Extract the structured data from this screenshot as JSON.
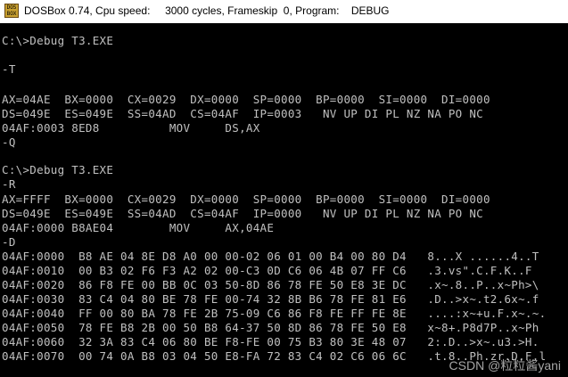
{
  "window": {
    "title": "DOSBox 0.74, Cpu speed:     3000 cycles, Frameskip  0, Program:    DEBUG",
    "icon": "dosbox-app-icon",
    "icon_text": "DOS BOX"
  },
  "console": {
    "lines": [
      "C:\\>Debug T3.EXE",
      "",
      "-T",
      "",
      "AX=04AE  BX=0000  CX=0029  DX=0000  SP=0000  BP=0000  SI=0000  DI=0000",
      "DS=049E  ES=049E  SS=04AD  CS=04AF  IP=0003   NV UP DI PL NZ NA PO NC",
      "04AF:0003 8ED8          MOV     DS,AX",
      "-Q",
      "",
      "C:\\>Debug T3.EXE",
      "-R",
      "AX=FFFF  BX=0000  CX=0029  DX=0000  SP=0000  BP=0000  SI=0000  DI=0000",
      "DS=049E  ES=049E  SS=04AD  CS=04AF  IP=0000   NV UP DI PL NZ NA PO NC",
      "04AF:0000 B8AE04        MOV     AX,04AE",
      "-D",
      "04AF:0000  B8 AE 04 8E D8 A0 00 00-02 06 01 00 B4 00 80 D4   8...X ......4..T",
      "04AF:0010  00 B3 02 F6 F3 A2 02 00-C3 0D C6 06 4B 07 FF C6   .3.vs\".C.F.K..F",
      "04AF:0020  86 F8 FE 00 BB 0C 03 50-8D 86 78 FE 50 E8 3E DC   .x~.8..P..x~Ph>\\",
      "04AF:0030  83 C4 04 80 BE 78 FE 00-74 32 8B B6 78 FE 81 E6   .D..>x~.t2.6x~.f",
      "04AF:0040  FF 00 80 BA 78 FE 2B 75-09 C6 86 F8 FE FF FE 8E   ....:x~+u.F.x~.~.",
      "04AF:0050  78 FE B8 2B 00 50 B8 64-37 50 8D 86 78 FE 50 E8   x~8+.P8d7P..x~Ph",
      "04AF:0060  32 3A 83 C4 06 80 BE F8-FE 00 75 B3 80 3E 48 07   2:.D..>x~.u3.>H.",
      "04AF:0070  00 74 0A B8 03 04 50 E8-FA 72 83 C4 02 C6 06 6C   .t.8..Ph.zr.D.F.l"
    ]
  },
  "watermark": "CSDN @粒粒酱yani"
}
